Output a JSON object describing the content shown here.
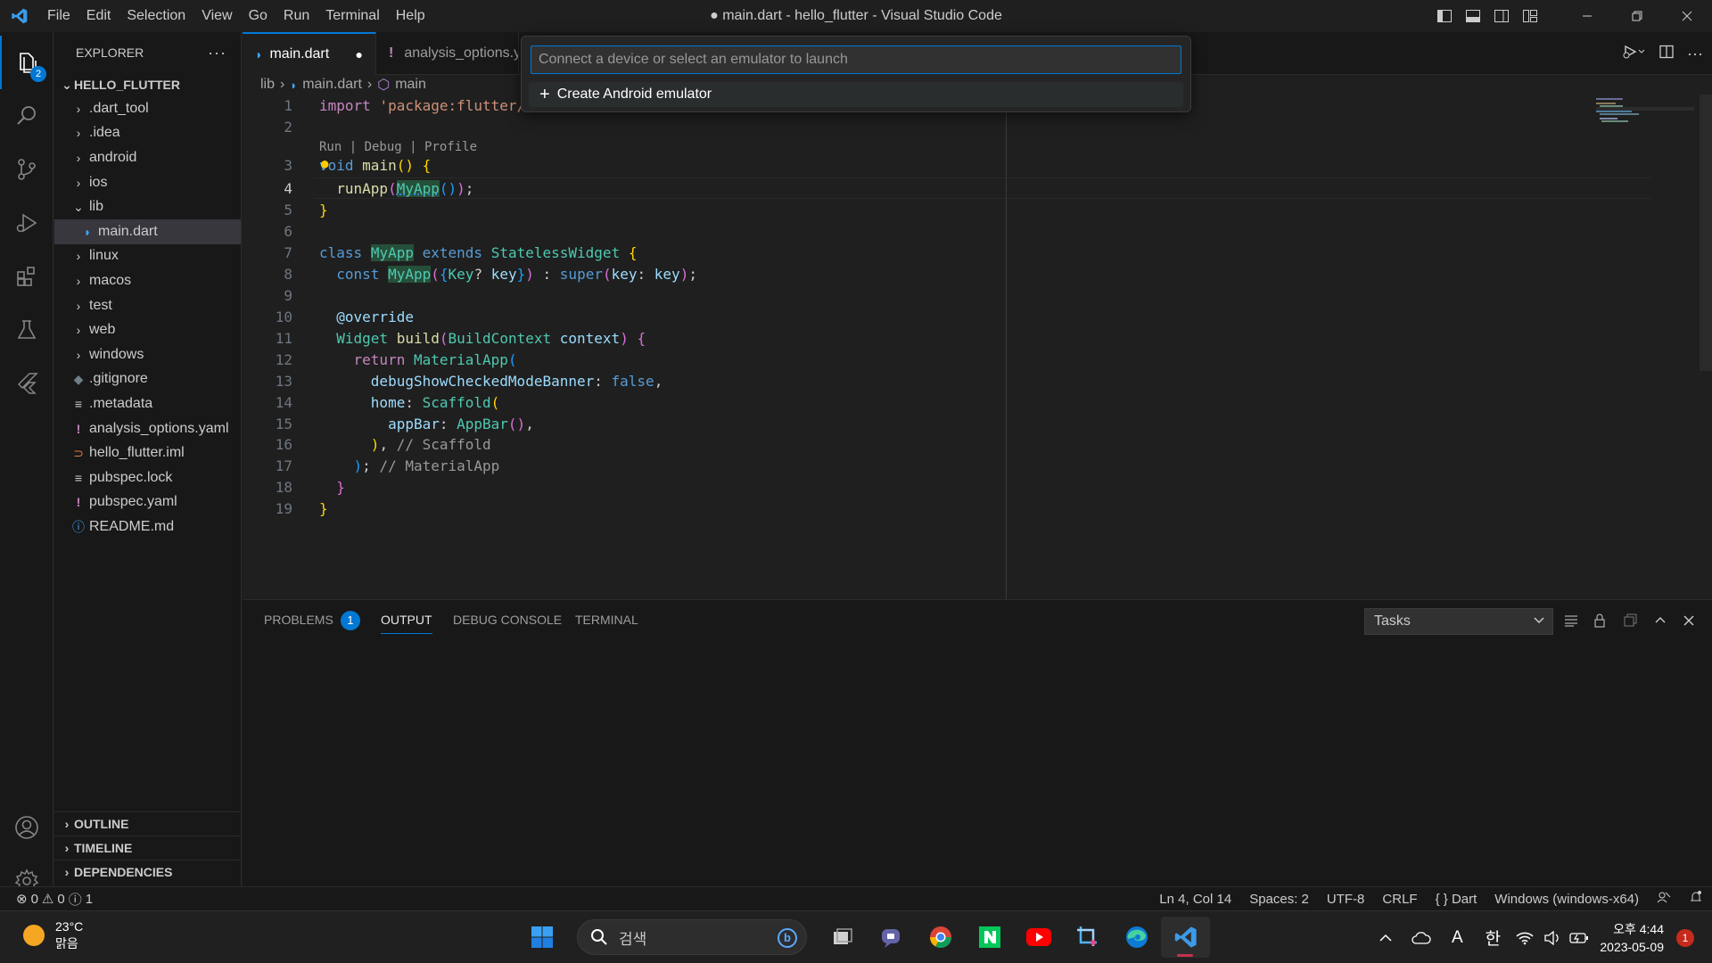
{
  "window": {
    "title": "● main.dart - hello_flutter - Visual Studio Code",
    "menu": [
      "File",
      "Edit",
      "Selection",
      "View",
      "Go",
      "Run",
      "Terminal",
      "Help"
    ]
  },
  "activity_bar": {
    "explorer_badge": "2"
  },
  "sidebar": {
    "header": "EXPLORER",
    "folder": "HELLO_FLUTTER",
    "items": [
      {
        "label": ".dart_tool",
        "kind": "folder"
      },
      {
        "label": ".idea",
        "kind": "folder"
      },
      {
        "label": "android",
        "kind": "folder"
      },
      {
        "label": "ios",
        "kind": "folder"
      },
      {
        "label": "lib",
        "kind": "folder-open"
      },
      {
        "label": "main.dart",
        "kind": "dart-file"
      },
      {
        "label": "linux",
        "kind": "folder"
      },
      {
        "label": "macos",
        "kind": "folder"
      },
      {
        "label": "test",
        "kind": "folder"
      },
      {
        "label": "web",
        "kind": "folder"
      },
      {
        "label": "windows",
        "kind": "folder"
      },
      {
        "label": ".gitignore",
        "kind": "git-file"
      },
      {
        "label": ".metadata",
        "kind": "text-file"
      },
      {
        "label": "analysis_options.yaml",
        "kind": "yaml-file"
      },
      {
        "label": "hello_flutter.iml",
        "kind": "rss-file"
      },
      {
        "label": "pubspec.lock",
        "kind": "text-file"
      },
      {
        "label": "pubspec.yaml",
        "kind": "yaml-file"
      },
      {
        "label": "README.md",
        "kind": "info-file"
      }
    ],
    "sections": [
      "OUTLINE",
      "TIMELINE",
      "DEPENDENCIES"
    ]
  },
  "tabs": [
    {
      "label": "main.dart",
      "dirty": "●"
    },
    {
      "label": "analysis_options.y"
    }
  ],
  "breadcrumb": [
    "lib",
    "main.dart",
    "main"
  ],
  "quick_pick": {
    "placeholder": "Connect a device or select an emulator to launch",
    "items": [
      "Create Android emulator"
    ]
  },
  "editor": {
    "line_numbers": [
      "1",
      "2",
      "3",
      "4",
      "5",
      "6",
      "7",
      "8",
      "9",
      "10",
      "11",
      "12",
      "13",
      "14",
      "15",
      "16",
      "17",
      "18",
      "19"
    ],
    "current_line": "4",
    "codelens": "Run | Debug | Profile",
    "code": {
      "l1_kw": "import",
      "l1_str": "'package:flutter/",
      "l3_kw": "void",
      "l3_fn": "main",
      "l4_fn": "runApp",
      "l4_cls": "MyApp",
      "l7_kw": "class",
      "l7_cls": "MyApp",
      "l7_kw2": "extends",
      "l7_base": "StatelessWidget",
      "l8_kw": "const",
      "l8_cls": "MyApp",
      "l8_type": "Key",
      "l8_param": "key",
      "l8_super": "super",
      "l8_named": "key",
      "l8_val": "key",
      "l10_ann": "@override",
      "l11_type": "Widget",
      "l11_fn": "build",
      "l11_ptype": "BuildContext",
      "l11_param": "context",
      "l12_kw": "return",
      "l12_cls": "MaterialApp",
      "l13_prop": "debugShowCheckedModeBanner",
      "l13_val": "false",
      "l14_prop": "home",
      "l14_cls": "Scaffold",
      "l15_prop": "appBar",
      "l15_cls": "AppBar",
      "l16_cmt": "// Scaffold",
      "l17_cmt": "// MaterialApp"
    }
  },
  "panel": {
    "tabs": [
      "PROBLEMS",
      "OUTPUT",
      "DEBUG CONSOLE",
      "TERMINAL"
    ],
    "problems_count": "1",
    "active_tab": "OUTPUT",
    "tasks_select": "Tasks"
  },
  "status_bar": {
    "errors": "0",
    "warnings": "0",
    "infos": "1",
    "position": "Ln 4, Col 14",
    "spaces": "Spaces: 2",
    "encoding": "UTF-8",
    "eol": "CRLF",
    "language": "Dart",
    "device": "Windows (windows-x64)"
  },
  "taskbar": {
    "temperature": "23°C",
    "weather": "맑음",
    "search_label": "검색",
    "ime_a": "A",
    "ime_lang": "한",
    "time": "오후 4:44",
    "date": "2023-05-09",
    "notifications": "1"
  },
  "colors": {
    "accent": "#0078d4",
    "editor_bg": "#1f1f1f",
    "sidebar_bg": "#181818"
  }
}
